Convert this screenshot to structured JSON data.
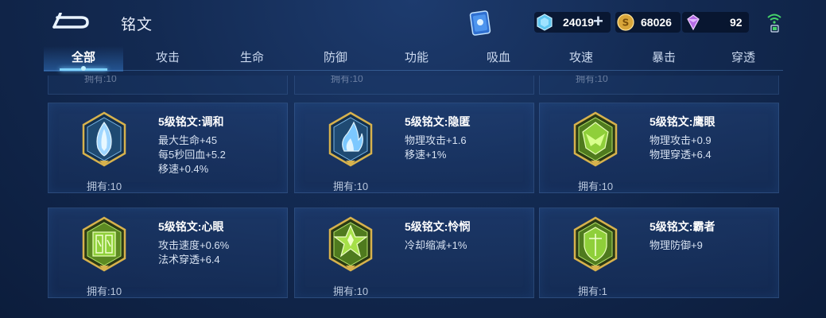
{
  "header": {
    "title": "铭文",
    "currencies": [
      {
        "name": "diamond",
        "icon": "diamond-icon",
        "value": "24019"
      },
      {
        "name": "gold",
        "icon": "gold-coin-icon",
        "value": "68026"
      },
      {
        "name": "crystal",
        "icon": "purple-crystal-icon",
        "value": "92"
      }
    ]
  },
  "tabs": [
    {
      "label": "全部",
      "active": true
    },
    {
      "label": "攻击"
    },
    {
      "label": "生命"
    },
    {
      "label": "防御"
    },
    {
      "label": "功能"
    },
    {
      "label": "吸血"
    },
    {
      "label": "攻速"
    },
    {
      "label": "暴击"
    },
    {
      "label": "穿透"
    }
  ],
  "ghost_row": [
    "拥有:10",
    "拥有:10",
    "拥有:10"
  ],
  "cards": [
    {
      "name": "5级铭文:调和",
      "stats": [
        "最大生命+45",
        "每5秒回血+5.2",
        "移速+0.4%"
      ],
      "owned": "拥有:10",
      "gem": "blue-gem-icon",
      "color": "#6fb6e8"
    },
    {
      "name": "5级铭文:隐匿",
      "stats": [
        "物理攻击+1.6",
        "移速+1%"
      ],
      "owned": "拥有:10",
      "gem": "blue-flame-gem-icon",
      "color": "#6fb6e8"
    },
    {
      "name": "5级铭文:鹰眼",
      "stats": [
        "物理攻击+0.9",
        "物理穿透+6.4"
      ],
      "owned": "拥有:10",
      "gem": "green-eagle-gem-icon",
      "color": "#9bd24a"
    },
    {
      "name": "5级铭文:心眼",
      "stats": [
        "攻击速度+0.6%",
        "法术穿透+6.4"
      ],
      "owned": "拥有:10",
      "gem": "green-gate-gem-icon",
      "color": "#9bd24a"
    },
    {
      "name": "5级铭文:怜悯",
      "stats": [
        "冷却缩减+1%"
      ],
      "owned": "拥有:10",
      "gem": "green-star-gem-icon",
      "color": "#9bd24a"
    },
    {
      "name": "5级铭文:霸者",
      "stats": [
        "物理防御+9"
      ],
      "owned": "拥有:1",
      "gem": "green-shield-gem-icon",
      "color": "#9bd24a"
    }
  ]
}
